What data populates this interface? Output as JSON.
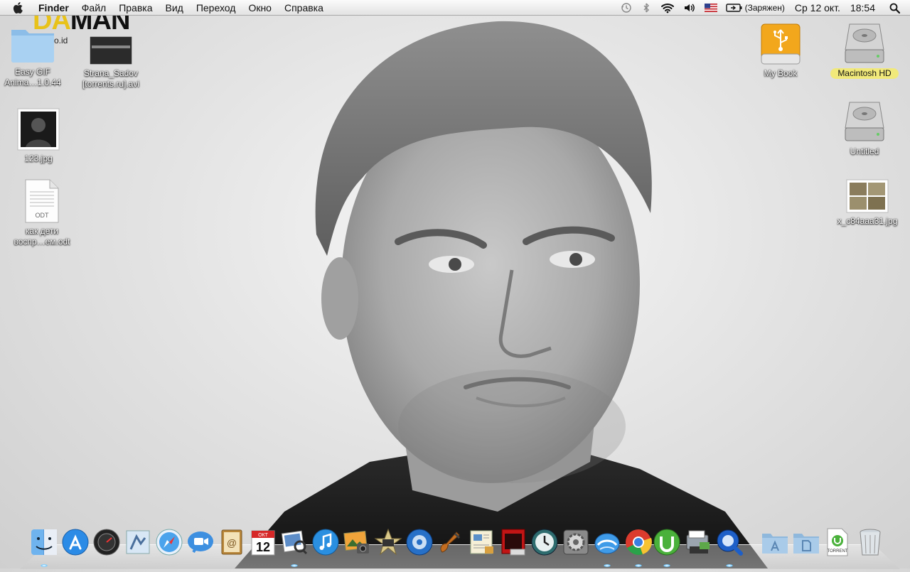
{
  "menubar": {
    "app_name": "Finder",
    "menus": [
      "Файл",
      "Правка",
      "Вид",
      "Переход",
      "Окно",
      "Справка"
    ],
    "status": {
      "battery_state": "(Заряжен)",
      "date": "Ср 12 окт.",
      "time": "18:54"
    },
    "icons": [
      "apple-icon",
      "time-machine-icon",
      "bluetooth-icon",
      "wifi-icon",
      "volume-icon",
      "us-flag-icon",
      "battery-icon",
      "spotlight-icon"
    ]
  },
  "wallpaper": {
    "logo_da": "DA",
    "logo_man": "MAN",
    "site": "n.co.id"
  },
  "desktop": {
    "left_icons": [
      {
        "label_line1": "Easy GIF",
        "label_line2": "Anima…1.0.44",
        "kind": "folder"
      },
      {
        "label_line1": "Strana_Sadov",
        "label_line2": "[torrents.ru].avi",
        "kind": "video"
      },
      {
        "label_line1": "123.jpg",
        "label_line2": "",
        "kind": "image"
      },
      {
        "label_line1": "как дети",
        "label_line2": "воспр…ем.odt",
        "kind": "document",
        "badge": "ODT"
      }
    ],
    "right_icons": [
      {
        "label": "My Book",
        "kind": "usb-drive"
      },
      {
        "label": "Macintosh HD",
        "kind": "hard-drive",
        "selected": true
      },
      {
        "label": "Untitled",
        "kind": "hard-drive"
      },
      {
        "label": "x_c84aaa31.jpg",
        "kind": "image"
      }
    ]
  },
  "dock": {
    "items": [
      {
        "name": "Finder",
        "icon": "finder-icon",
        "running": true
      },
      {
        "name": "App Store",
        "icon": "app-store-icon",
        "running": false
      },
      {
        "name": "Dashboard",
        "icon": "dashboard-icon",
        "running": false
      },
      {
        "name": "Mail",
        "icon": "mail-icon",
        "running": false
      },
      {
        "name": "Safari",
        "icon": "safari-icon",
        "running": false
      },
      {
        "name": "FaceTime",
        "icon": "facetime-icon",
        "running": false
      },
      {
        "name": "Address Book",
        "icon": "address-book-icon",
        "running": false
      },
      {
        "name": "iCal",
        "icon": "ical-icon",
        "running": false,
        "cal_month": "ОКТ",
        "cal_day": "12"
      },
      {
        "name": "Preview",
        "icon": "preview-icon",
        "running": true
      },
      {
        "name": "iTunes",
        "icon": "itunes-icon",
        "running": false
      },
      {
        "name": "iPhoto",
        "icon": "iphoto-icon",
        "running": false
      },
      {
        "name": "iMovie",
        "icon": "imovie-icon",
        "running": false
      },
      {
        "name": "iDVD",
        "icon": "idvd-icon",
        "running": false
      },
      {
        "name": "GarageBand",
        "icon": "garageband-icon",
        "running": false
      },
      {
        "name": "iWeb",
        "icon": "iweb-icon",
        "running": false
      },
      {
        "name": "Photo Booth",
        "icon": "photo-booth-icon",
        "running": false
      },
      {
        "name": "Time Machine",
        "icon": "time-machine-icon",
        "running": false
      },
      {
        "name": "System Preferences",
        "icon": "system-preferences-icon",
        "running": false
      },
      {
        "name": "Mail Cloud",
        "icon": "cloud-mail-icon",
        "running": true
      },
      {
        "name": "Google Chrome",
        "icon": "chrome-icon",
        "running": true
      },
      {
        "name": "uTorrent",
        "icon": "utorrent-icon",
        "running": true
      },
      {
        "name": "Image Capture",
        "icon": "image-capture-icon",
        "running": false
      },
      {
        "name": "QuickTime Player",
        "icon": "quicktime-icon",
        "running": true
      },
      {
        "name": "Applications",
        "icon": "applications-stack-icon",
        "running": false
      },
      {
        "name": "Documents",
        "icon": "documents-stack-icon",
        "running": false
      },
      {
        "name": "Downloads",
        "icon": "torrent-file-icon",
        "running": false,
        "badge": "TORRENT"
      },
      {
        "name": "Trash",
        "icon": "trash-icon",
        "running": false
      }
    ]
  },
  "colors": {
    "menubar_bg": "#eeeeee",
    "selection_label": "#f1e97a",
    "logo_yellow": "#e8c21a"
  }
}
